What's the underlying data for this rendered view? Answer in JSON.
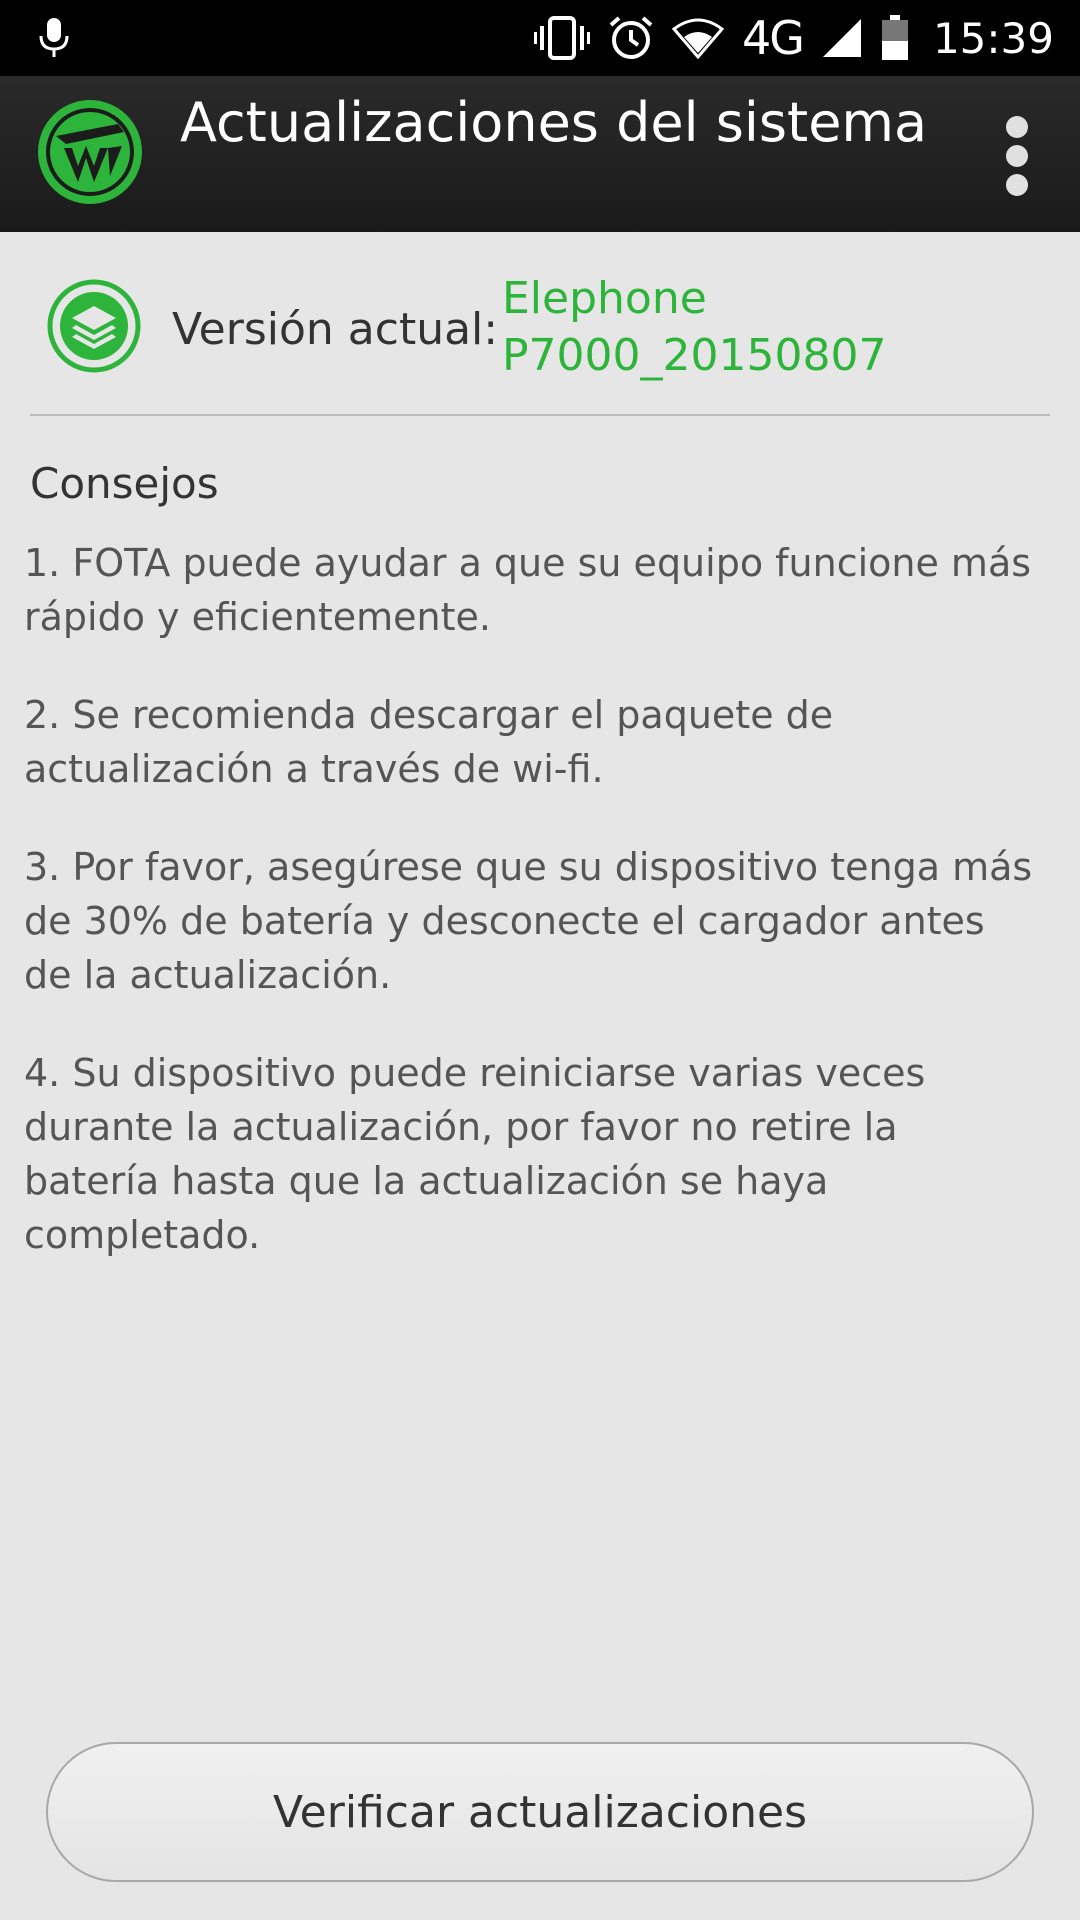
{
  "status_bar": {
    "network": "4G",
    "time": "15:39",
    "icons": [
      "microphone-icon",
      "vibrate-icon",
      "alarm-icon",
      "wifi-icon",
      "signal-icon",
      "battery-icon"
    ]
  },
  "app_bar": {
    "title": "Actualizaciones del sistema",
    "logo_icon": "app-logo-icon",
    "menu_icon": "overflow-menu-icon"
  },
  "version": {
    "label": "Versión actual:",
    "value": "Elephone P7000_20150807",
    "icon": "layers-icon"
  },
  "tips": {
    "title": "Consejos",
    "items": [
      "1. FOTA puede ayudar a que su equipo funcione más rápido y eficientemente.",
      "2. Se recomienda descargar el paquete de actualización a través de wi-fi.",
      "3. Por favor, asegúrese que su dispositivo tenga más de 30% de batería y desconecte el cargador antes de la actualización.",
      "4. Su dispositivo puede reiniciarse varias veces durante la actualización, por favor no retire la batería hasta que la actualización se haya completado."
    ]
  },
  "actions": {
    "check_label": "Verificar actualizaciones"
  },
  "colors": {
    "accent": "#2db43a",
    "background": "#e6e6e6",
    "app_bar": "#1f1f1f"
  }
}
